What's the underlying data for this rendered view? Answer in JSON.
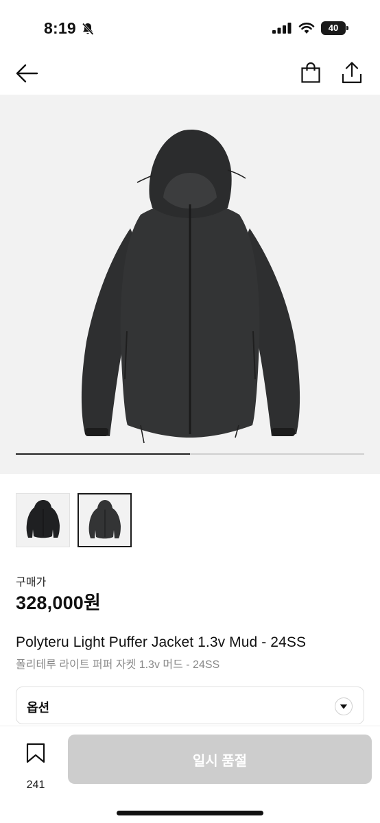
{
  "status_bar": {
    "time": "8:19",
    "battery": "40"
  },
  "nav": {
    "back_icon": "arrow-left-icon",
    "bag_icon": "shopping-bag-icon",
    "share_icon": "share-icon"
  },
  "gallery": {
    "image_count": 2,
    "current_index": 2,
    "progress": 0.5
  },
  "price": {
    "label": "구매가",
    "value": "328,000원"
  },
  "product": {
    "name": "Polyteru Light Puffer Jacket 1.3v Mud - 24SS",
    "subname": "폴리테루 라이트 퍼퍼 자켓 1.3v 머드 - 24SS"
  },
  "option": {
    "label": "옵션",
    "caret_icon": "triangle-down-icon"
  },
  "bottom": {
    "wish_count": "241",
    "button_label": "일시 품절"
  },
  "colors": {
    "accent": "#111111",
    "disabled_button": "#cdcdcd",
    "image_background": "#f2f2f2"
  }
}
